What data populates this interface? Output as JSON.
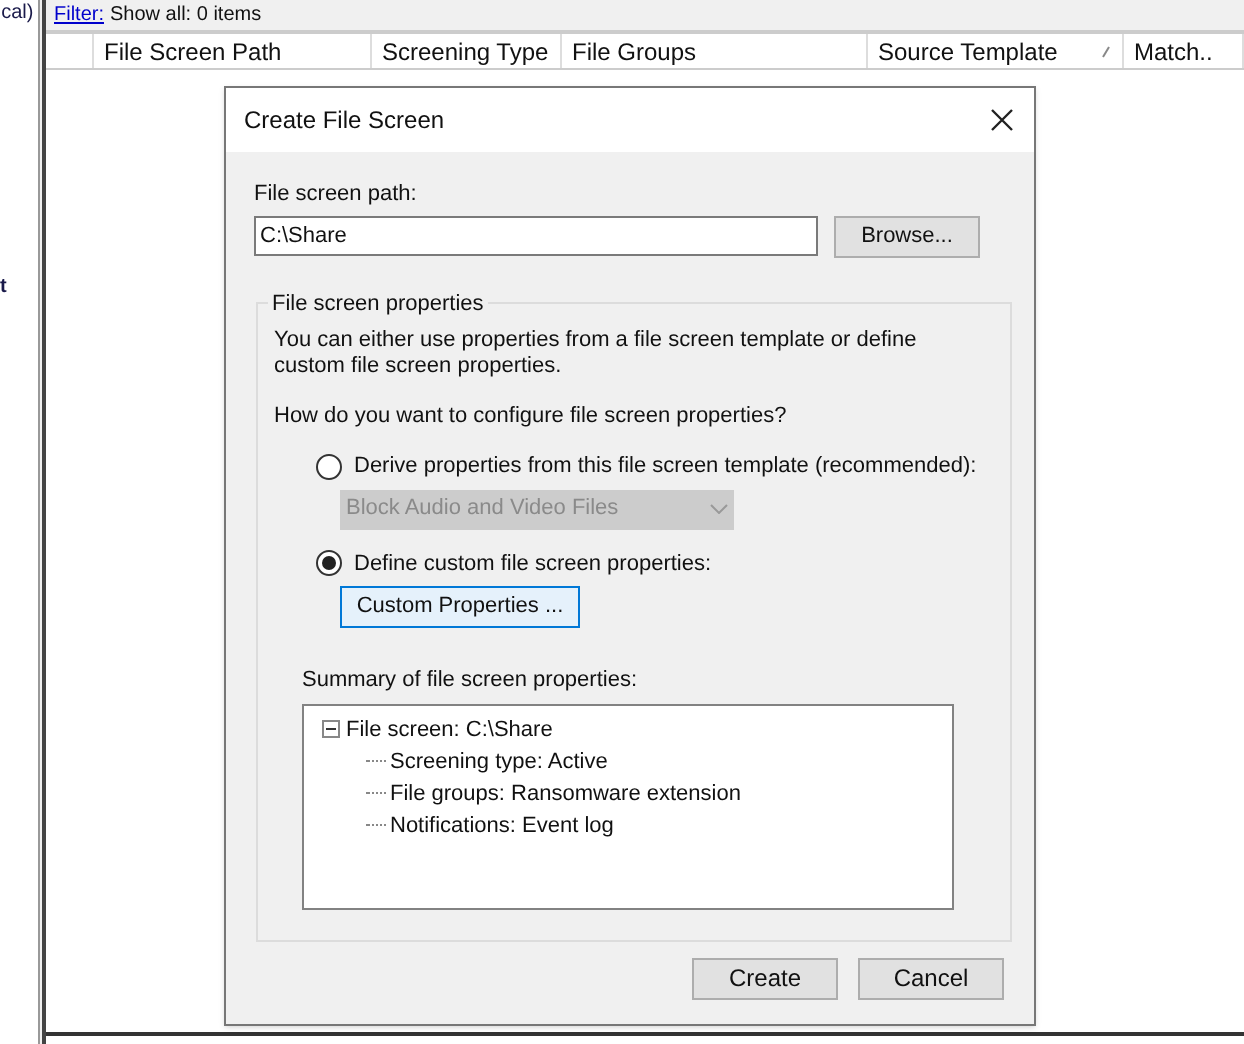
{
  "left_pane": {
    "fragments": [
      "cal)",
      "t"
    ]
  },
  "filter": {
    "link": "Filter:",
    "text": "Show all: 0 items"
  },
  "table": {
    "columns": [
      {},
      {
        "label": "File Screen Path"
      },
      {
        "label": "Screening Type"
      },
      {
        "label": "File Groups"
      },
      {
        "label": "Source Template",
        "sorted": true
      },
      {
        "label": "Match.."
      }
    ]
  },
  "dialog": {
    "title": "Create File Screen",
    "path_label": "File screen path:",
    "path_value": "C:\\Share",
    "browse_button": "Browse...",
    "group_title": "File screen properties",
    "description": "You can either use properties from a file screen template or define custom file screen properties.",
    "question": "How do you want to configure file screen properties?",
    "options": [
      {
        "label": "Derive properties from this file screen template (recommended):",
        "selected": false,
        "kind": "dropdown",
        "value": "Block Audio and Video Files",
        "disabled": true
      },
      {
        "label": "Define custom file screen properties:",
        "selected": true,
        "kind": "button",
        "button": "Custom Properties ..."
      }
    ],
    "summary_label": "Summary of file screen properties:",
    "summary_tree": [
      {
        "label": "File screen: C:\\Share",
        "expanded": true,
        "children": [
          {
            "label": "Screening type: Active"
          },
          {
            "label": "File groups: Ransomware extension"
          },
          {
            "label": "Notifications: Event log"
          }
        ]
      }
    ],
    "buttons": [
      "Create",
      "Cancel"
    ]
  }
}
